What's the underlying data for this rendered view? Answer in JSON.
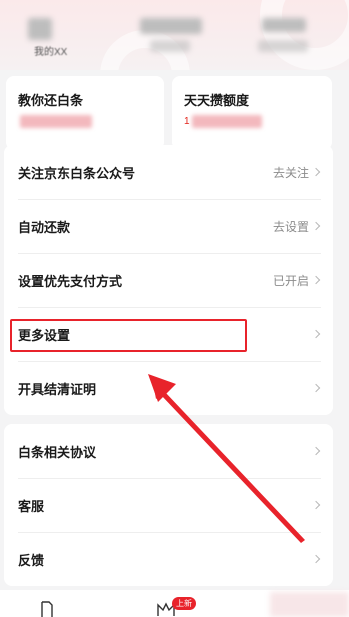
{
  "header": {
    "items": [
      {
        "label": "我的XX"
      },
      {
        "label": ""
      },
      {
        "label": ""
      }
    ]
  },
  "cards": [
    {
      "title": "教你还白条",
      "value": ""
    },
    {
      "title": "天天攒额度",
      "value": "1"
    }
  ],
  "settings_group_1": [
    {
      "label": "关注京东白条公众号",
      "status": "去关注"
    },
    {
      "label": "自动还款",
      "status": "去设置"
    },
    {
      "label": "设置优先支付方式",
      "status": "已开启"
    },
    {
      "label": "更多设置",
      "status": ""
    },
    {
      "label": "开具结清证明",
      "status": ""
    }
  ],
  "settings_group_2": [
    {
      "label": "白条相关协议"
    },
    {
      "label": "客服"
    },
    {
      "label": "反馈"
    }
  ],
  "bottom_nav": {
    "badge": "上新",
    "icons": [
      "document-icon",
      "crown-icon"
    ]
  },
  "colors": {
    "accent": "#e8232b",
    "annotation": "#e8232b"
  }
}
